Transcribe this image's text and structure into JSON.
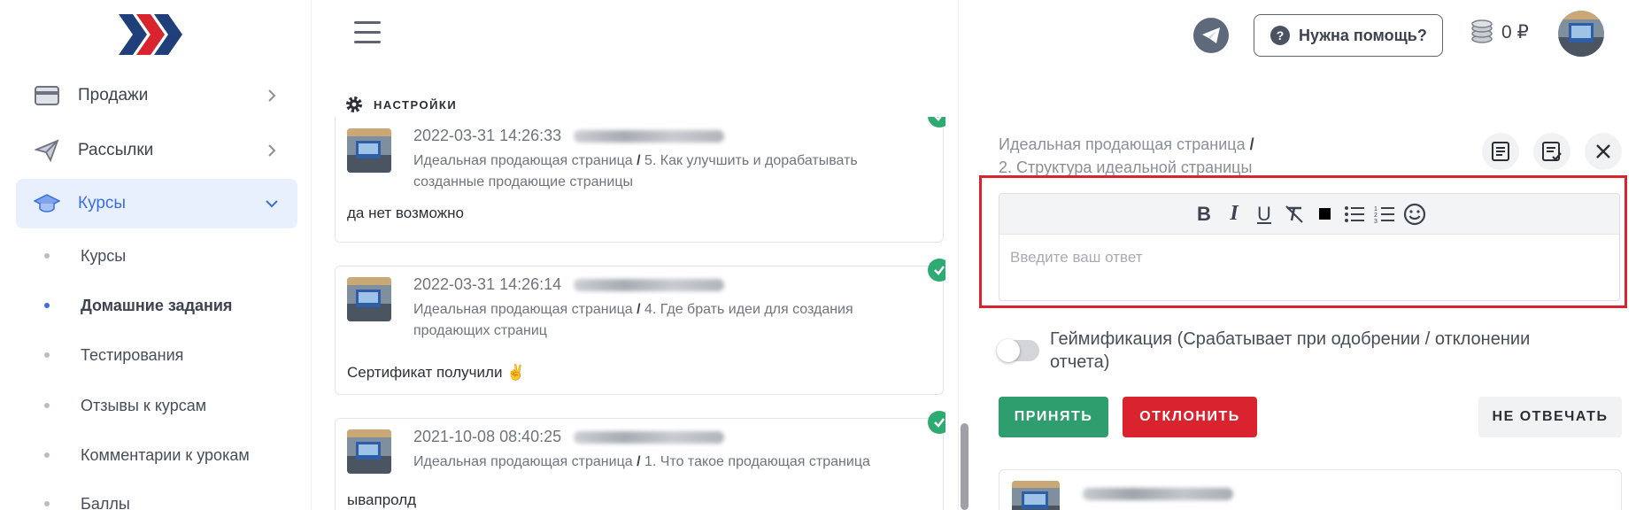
{
  "sidebar": {
    "items": [
      {
        "label": "Продажи",
        "icon": "credit-card-icon"
      },
      {
        "label": "Рассылки",
        "icon": "paper-plane-icon"
      },
      {
        "label": "Курсы",
        "icon": "graduation-cap-icon"
      }
    ],
    "sub_items": [
      {
        "label": "Курсы"
      },
      {
        "label": "Домашние задания"
      },
      {
        "label": "Тестирования"
      },
      {
        "label": "Отзывы к курсам"
      },
      {
        "label": "Комментарии к урокам"
      },
      {
        "label": "Баллы"
      }
    ]
  },
  "header": {
    "help_label": "Нужна помощь?",
    "balance": "0 ₽"
  },
  "settings": {
    "label": "НАСТРОЙКИ"
  },
  "submissions": [
    {
      "date": "2022-03-31 14:26:33",
      "course": "Идеальная продающая страница",
      "sep": "/",
      "lesson": "5. Как улучшить и дорабатывать созданные продающие страницы",
      "message": "да нет возможно"
    },
    {
      "date": "2022-03-31 14:26:14",
      "course": "Идеальная продающая страница",
      "sep": "/",
      "lesson": "4. Где брать идеи для создания продающих страниц",
      "message": "Сертификат получили ✌️"
    },
    {
      "date": "2021-10-08 08:40:25",
      "course": "Идеальная продающая страница",
      "sep": "/",
      "lesson": "1. Что такое продающая страница",
      "message": "ывапролд"
    }
  ],
  "detail": {
    "course": "Идеальная продающая страница",
    "sep": "/",
    "lesson": "2. Структура идеальной страницы",
    "editor_placeholder": "Введите ваш ответ",
    "gamification_label": "Геймификация (Срабатывает при одобрении / отклонении отчета)",
    "accept_label": "ПРИНЯТЬ",
    "reject_label": "ОТКЛОНИТЬ",
    "skip_label": "НЕ ОТВЕЧАТЬ"
  },
  "colors": {
    "accent": "#3b6fe0",
    "accept": "#2f9e6e",
    "reject": "#d9232e",
    "highlight": "#d9232e"
  }
}
